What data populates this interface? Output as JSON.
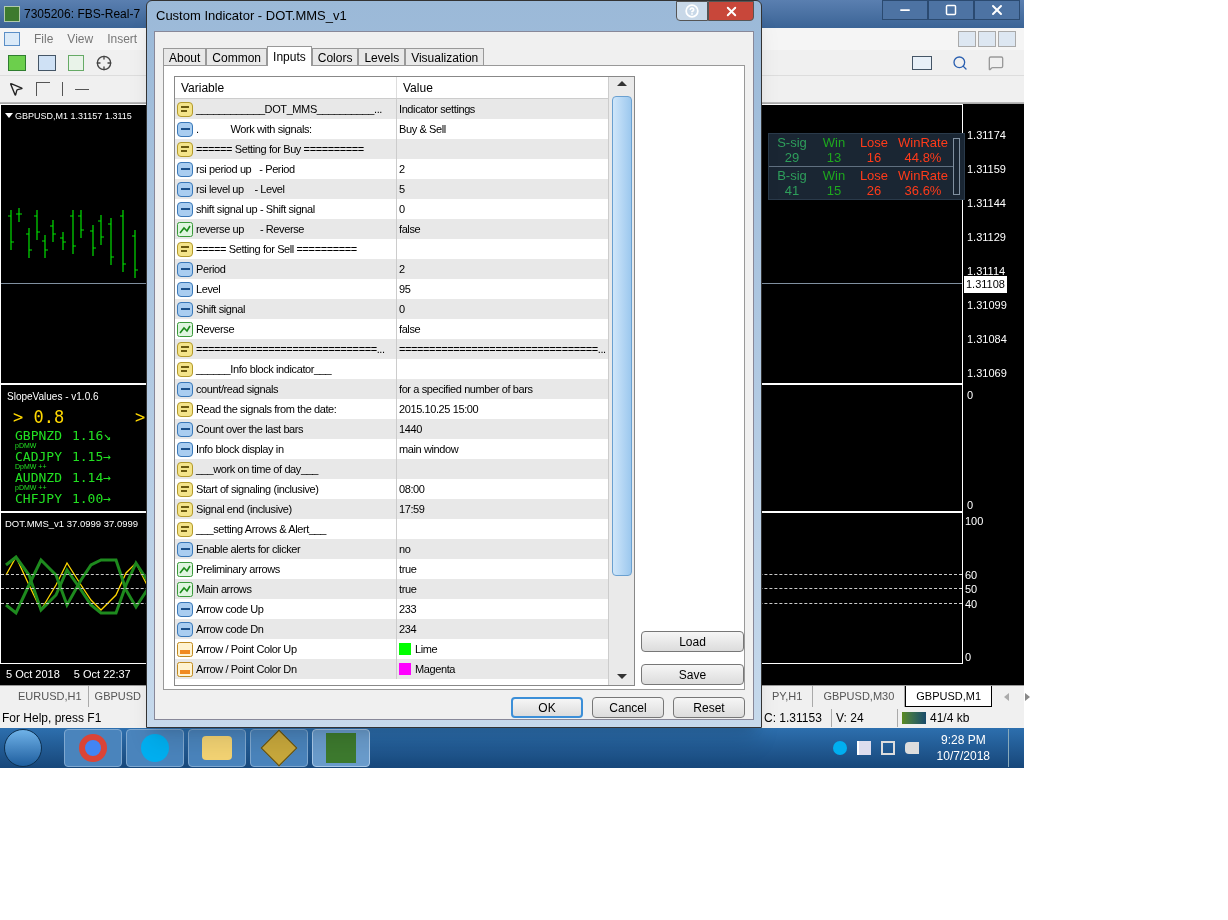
{
  "app_window": {
    "title": "7305206: FBS-Real-7",
    "menu": [
      "File",
      "View",
      "Insert"
    ]
  },
  "main_chart": {
    "label": "GBPUSD,M1  1.31157 1.3115",
    "price_axis": [
      {
        "text": "1.31174",
        "kind": "tick"
      },
      {
        "text": "1.31159",
        "kind": "tick"
      },
      {
        "text": "1.31144",
        "kind": "tick"
      },
      {
        "text": "1.31129",
        "kind": "tick"
      },
      {
        "text": "1.31114",
        "kind": "tick"
      },
      {
        "text": "1.31108",
        "kind": "current"
      },
      {
        "text": "1.31099",
        "kind": "tick"
      },
      {
        "text": "1.31084",
        "kind": "tick"
      },
      {
        "text": "1.31069",
        "kind": "tick"
      }
    ],
    "info_block": {
      "rows": [
        [
          {
            "text": "S-sig",
            "color": "#2e9e5b"
          },
          {
            "text": "Win",
            "color": "#1ea81e"
          },
          {
            "text": "Lose",
            "color": "#ff3b1a"
          },
          {
            "text": "WinRate",
            "color": "#ff3b1a"
          }
        ],
        [
          {
            "text": "29",
            "color": "#2e9e5b"
          },
          {
            "text": "13",
            "color": "#1ea81e"
          },
          {
            "text": "16",
            "color": "#ff3b1a"
          },
          {
            "text": "44.8%",
            "color": "#ff3b1a"
          }
        ],
        [
          {
            "text": "B-sig",
            "color": "#2e9e5b"
          },
          {
            "text": "Win",
            "color": "#1ea81e"
          },
          {
            "text": "Lose",
            "color": "#ff3b1a"
          },
          {
            "text": "WinRate",
            "color": "#ff3b1a"
          }
        ],
        [
          {
            "text": "41",
            "color": "#2e9e5b"
          },
          {
            "text": "15",
            "color": "#1ea81e"
          },
          {
            "text": "26",
            "color": "#ff3b1a"
          },
          {
            "text": "36.6%",
            "color": "#ff3b1a"
          }
        ]
      ]
    }
  },
  "slope_pane": {
    "title": "SlopeValues - v1.0.6",
    "headline": "> 0.8",
    "headline_2": ">",
    "pairs": [
      {
        "symbol": "GBPNZD",
        "value": "1.16",
        "arrow": "↘",
        "note": "pDMW"
      },
      {
        "symbol": "CADJPY",
        "value": "1.15",
        "arrow": "→",
        "note": "DpMW ++"
      },
      {
        "symbol": "AUDNZD",
        "value": "1.14",
        "arrow": "→",
        "note": "pDMW ++"
      },
      {
        "symbol": "CHFJPY",
        "value": "1.00",
        "arrow": "→"
      }
    ],
    "axis": [
      "0",
      "0"
    ]
  },
  "dot_pane": {
    "label": "DOT.MMS_v1 37.0999 37.0999",
    "axis": [
      {
        "text": "100",
        "kind": "tick"
      },
      {
        "text": "60",
        "kind": "level"
      },
      {
        "text": "50",
        "kind": "level"
      },
      {
        "text": "40",
        "kind": "level"
      },
      {
        "text": "0",
        "kind": "tick"
      }
    ]
  },
  "time_axis": [
    "5 Oct 2018",
    "5 Oct 22:37"
  ],
  "chart_tabs": [
    {
      "label": "EURUSD,H1",
      "selected": false
    },
    {
      "label": "GBPUSD",
      "selected": false
    },
    {
      "label": "PY,H1",
      "selected": false
    },
    {
      "label": "GBPUSD,M30",
      "selected": false
    },
    {
      "label": "GBPUSD,M1",
      "selected": true
    }
  ],
  "status_bar": {
    "help": "For Help, press F1",
    "close": "C: 1.31153",
    "volume": "V: 24",
    "traffic": "41/4 kb"
  },
  "taskbar": {
    "time": "9:28 PM",
    "date": "10/7/2018"
  },
  "dialog": {
    "title": "Custom Indicator - DOT.MMS_v1",
    "tabs": [
      {
        "label": "About",
        "selected": false
      },
      {
        "label": "Common",
        "selected": false
      },
      {
        "label": "Inputs",
        "selected": true
      },
      {
        "label": "Colors",
        "selected": false
      },
      {
        "label": "Levels",
        "selected": false
      },
      {
        "label": "Visualization",
        "selected": false
      }
    ],
    "columns": [
      "Variable",
      "Value"
    ],
    "rows": [
      {
        "kind": "string",
        "variable": "____________DOT_MMS__________...",
        "value": "Indicator settings"
      },
      {
        "kind": "int",
        "variable": ".            Work with signals:",
        "value": "Buy & Sell"
      },
      {
        "kind": "string",
        "variable": "====== Setting for Buy ==========",
        "value": ""
      },
      {
        "kind": "int",
        "variable": "rsi period up   - Period",
        "value": "2"
      },
      {
        "kind": "int",
        "variable": "rsi level up    - Level",
        "value": "5"
      },
      {
        "kind": "int",
        "variable": "shift signal up - Shift signal",
        "value": "0"
      },
      {
        "kind": "bool",
        "variable": "reverse up      - Reverse",
        "value": "false"
      },
      {
        "kind": "string",
        "variable": "===== Setting for Sell ==========",
        "value": ""
      },
      {
        "kind": "int",
        "variable": "Period",
        "value": "2"
      },
      {
        "kind": "int",
        "variable": "Level",
        "value": "95"
      },
      {
        "kind": "int",
        "variable": "Shift signal",
        "value": "0"
      },
      {
        "kind": "bool",
        "variable": "Reverse",
        "value": "false"
      },
      {
        "kind": "string",
        "variable": "==============================...",
        "value": "=================================..."
      },
      {
        "kind": "string",
        "variable": "______Info block indicator___",
        "value": ""
      },
      {
        "kind": "int",
        "variable": "count/read signals",
        "value": "for a specified number of bars"
      },
      {
        "kind": "string",
        "variable": "Read the signals from the date:",
        "value": "2015.10.25 15:00"
      },
      {
        "kind": "int",
        "variable": "Count over the last bars",
        "value": "1440"
      },
      {
        "kind": "int",
        "variable": "Info block display in",
        "value": "main window"
      },
      {
        "kind": "string",
        "variable": "___work on time of day___",
        "value": ""
      },
      {
        "kind": "string",
        "variable": "Start of signaling (inclusive)",
        "value": "08:00"
      },
      {
        "kind": "string",
        "variable": "Signal end (inclusive)",
        "value": "17:59"
      },
      {
        "kind": "string",
        "variable": "___setting Arrows & Alert___",
        "value": ""
      },
      {
        "kind": "int",
        "variable": "Enable alerts for clicker",
        "value": "no"
      },
      {
        "kind": "bool",
        "variable": "Preliminary arrows",
        "value": "true"
      },
      {
        "kind": "bool",
        "variable": "Main arrows",
        "value": "true"
      },
      {
        "kind": "int",
        "variable": "Arrow code Up",
        "value": "233"
      },
      {
        "kind": "int",
        "variable": "Arrow code Dn",
        "value": "234"
      },
      {
        "kind": "color",
        "variable": "Arrow / Point Color Up",
        "value": "Lime",
        "color": "#00ff00"
      },
      {
        "kind": "color",
        "variable": "Arrow / Point Color Dn",
        "value": "Magenta",
        "color": "#ff00ff"
      }
    ],
    "side_buttons": [
      "Load",
      "Save"
    ],
    "buttons": [
      {
        "label": "OK",
        "default": true
      },
      {
        "label": "Cancel",
        "default": false
      },
      {
        "label": "Reset",
        "default": false
      }
    ]
  }
}
